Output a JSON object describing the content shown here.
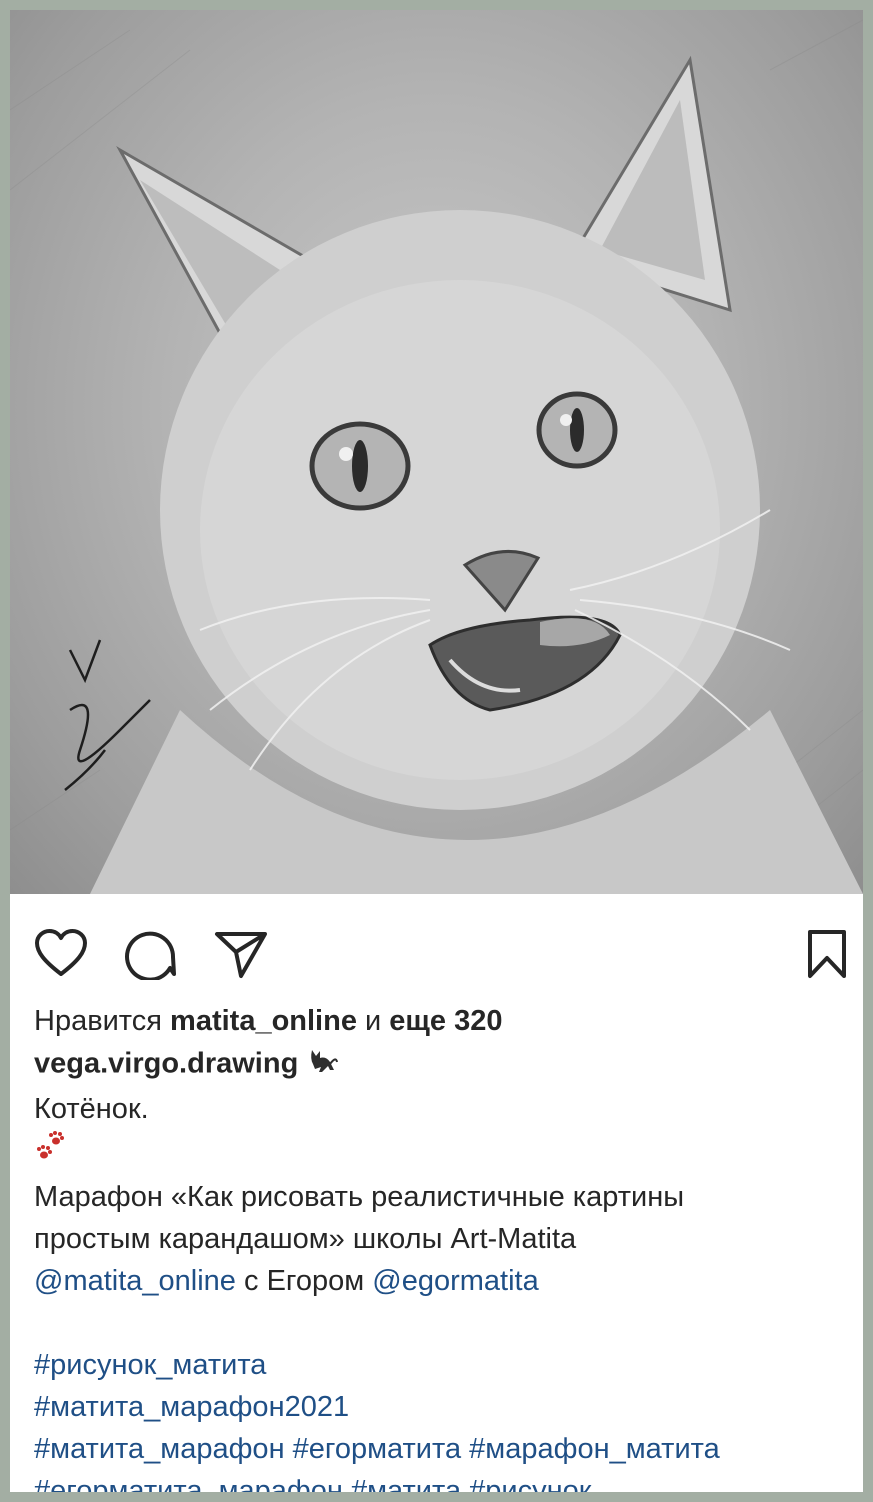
{
  "post": {
    "image_alt": "pencil drawing of a kitten",
    "signature_mark": "V '21"
  },
  "actions": {
    "like_icon": "heart-icon",
    "comment_icon": "comment-icon",
    "share_icon": "send-icon",
    "save_icon": "bookmark-icon"
  },
  "likes": {
    "prefix": "Нравится",
    "user": "matita_online",
    "middle": "и",
    "rest": "еще 320"
  },
  "caption": {
    "author": "vega.virgo.drawing",
    "author_emoji": "black-cat-icon",
    "title": "Котёнок.",
    "paws_emoji": "paw-prints-icon",
    "line1": "Марафон «Как рисовать реалистичные картины",
    "line2": "простым карандашом» школы Art-Matita",
    "mention1": "@matita_online",
    "with_text": "с Егором",
    "mention2": "@egormatita",
    "hashtags": [
      "#рисунок_матита",
      "#матита_марафон2021",
      "#матита_марафон",
      "#егорматита",
      "#марафон_матита",
      "#егорматита_марафон",
      "#матита",
      "#рисунок"
    ]
  }
}
